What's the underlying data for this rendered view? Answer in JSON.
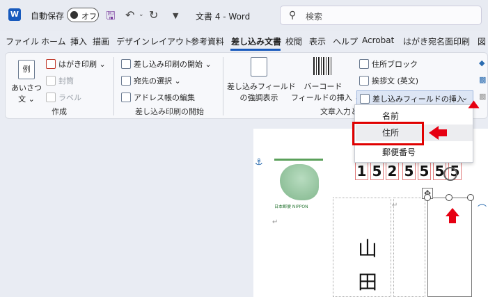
{
  "titlebar": {
    "app_logo": "W",
    "autosave_label": "自動保存",
    "autosave_state": "オフ",
    "doc_title": "文書 4 - Word",
    "search_placeholder": "検索"
  },
  "tabs": [
    {
      "label": "ファイル"
    },
    {
      "label": "ホーム"
    },
    {
      "label": "挿入"
    },
    {
      "label": "描画"
    },
    {
      "label": "デザイン"
    },
    {
      "label": "レイアウト"
    },
    {
      "label": "参考資料"
    },
    {
      "label": "差し込み文書",
      "active": true
    },
    {
      "label": "校閲"
    },
    {
      "label": "表示"
    },
    {
      "label": "ヘルプ"
    },
    {
      "label": "Acrobat"
    },
    {
      "label": "はがき宛名面印刷"
    },
    {
      "label": "図"
    }
  ],
  "ribbon": {
    "create_group": {
      "label": "作成",
      "greeting_line1": "あいさつ",
      "greeting_line2": "文 ⌄",
      "example_icon_text": "例",
      "postcard_print": "はがき印刷 ⌄",
      "envelope": "封筒",
      "label_btn": "ラベル"
    },
    "start_group": {
      "label": "差し込み印刷の開始",
      "start_merge": "差し込み印刷の開始 ⌄",
      "select_recipients": "宛先の選択 ⌄",
      "edit_address_book": "アドレス帳の編集"
    },
    "fields_group": {
      "label": "文章入力と",
      "highlight_line1": "差し込みフィールド",
      "highlight_line2": "の強調表示",
      "barcode_line1": "バーコード",
      "barcode_line2": "フィールドの挿入 ⌄",
      "address_block": "住所ブロック",
      "greeting_line": "挨拶文 (英文)",
      "insert_merge_field": "差し込みフィールドの挿入"
    }
  },
  "menu": {
    "items": [
      "名前",
      "住所",
      "郵便番号"
    ]
  },
  "document": {
    "postal_digits": [
      "1",
      "5",
      "2",
      "5",
      "5",
      "5",
      "5"
    ],
    "name_chars": [
      "山",
      "田"
    ],
    "stamp_text": "日本郵便   NIPPON"
  },
  "colors": {
    "accent": "#185abd",
    "annotation_red": "#e00000"
  }
}
